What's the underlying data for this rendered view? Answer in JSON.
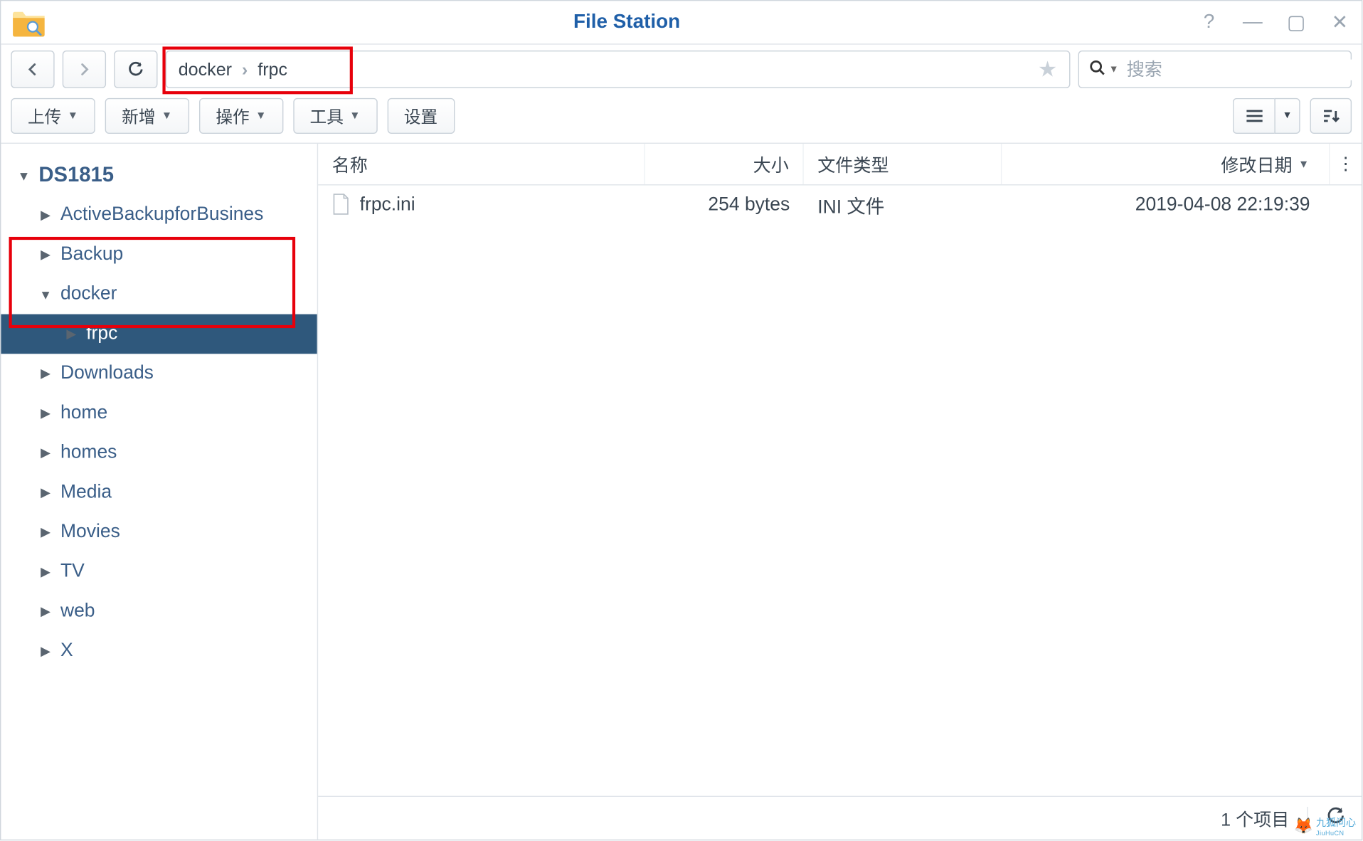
{
  "window": {
    "title": "File Station"
  },
  "breadcrumb": {
    "seg1": "docker",
    "seg2": "frpc"
  },
  "search": {
    "placeholder": "搜索"
  },
  "toolbar": {
    "upload": "上传",
    "create": "新增",
    "action": "操作",
    "tools": "工具",
    "settings": "设置"
  },
  "treeRoot": "DS1815",
  "tree": [
    {
      "label": "ActiveBackupforBusines",
      "expanded": false,
      "level": 1
    },
    {
      "label": "Backup",
      "expanded": false,
      "level": 1
    },
    {
      "label": "docker",
      "expanded": true,
      "level": 1
    },
    {
      "label": "frpc",
      "expanded": false,
      "level": 2,
      "selected": true
    },
    {
      "label": "Downloads",
      "expanded": false,
      "level": 1
    },
    {
      "label": "home",
      "expanded": false,
      "level": 1
    },
    {
      "label": "homes",
      "expanded": false,
      "level": 1
    },
    {
      "label": "Media",
      "expanded": false,
      "level": 1
    },
    {
      "label": "Movies",
      "expanded": false,
      "level": 1
    },
    {
      "label": "TV",
      "expanded": false,
      "level": 1
    },
    {
      "label": "web",
      "expanded": false,
      "level": 1
    },
    {
      "label": "X",
      "expanded": false,
      "level": 1
    }
  ],
  "columns": {
    "name": "名称",
    "size": "大小",
    "type": "文件类型",
    "date": "修改日期"
  },
  "files": [
    {
      "name": "frpc.ini",
      "size": "254 bytes",
      "type": "INI 文件",
      "date": "2019-04-08 22:19:39"
    }
  ],
  "status": {
    "count": "1 个项目"
  },
  "watermark": {
    "text": "九狐问心",
    "sub": "JiuHuCN"
  }
}
